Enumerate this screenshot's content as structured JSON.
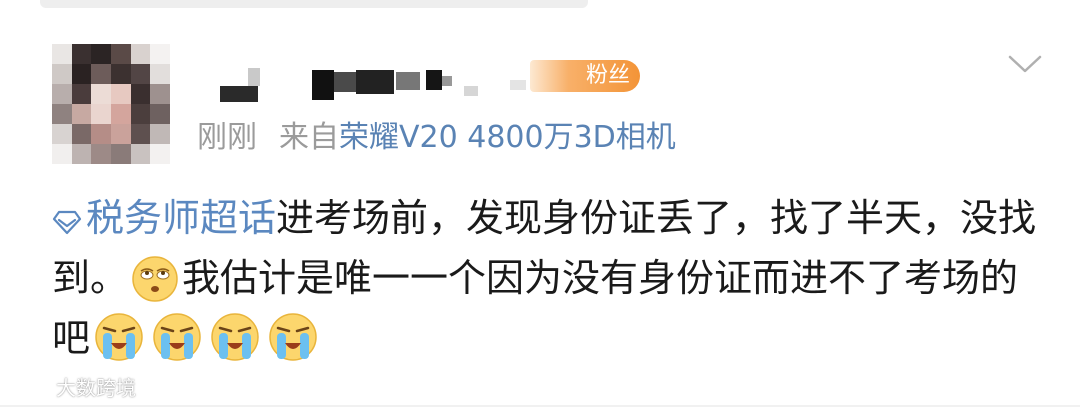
{
  "meta": {
    "time": "刚刚",
    "source_prefix": "来自",
    "device": "荣耀V20 4800万3D相机"
  },
  "badge": {
    "label": "粉丝"
  },
  "post": {
    "topic": "税务师超话",
    "text1": "进考场前，发现身份证丢了，找了半天，没找到。",
    "text2": "我估计是唯一一个因为没有身份证而进不了考场的吧"
  },
  "watermark": {
    "text": "大数跨境"
  },
  "icons": {
    "topic": "super-topic-diamond-icon",
    "eyeroll": "eye-roll-emoji",
    "crying": "loudly-crying-emoji",
    "menu": "chevron-down-icon"
  },
  "colors": {
    "link": "#5b88c0",
    "device": "#5a83b4",
    "meta": "#9b9b9b",
    "badge": "#f39437"
  }
}
